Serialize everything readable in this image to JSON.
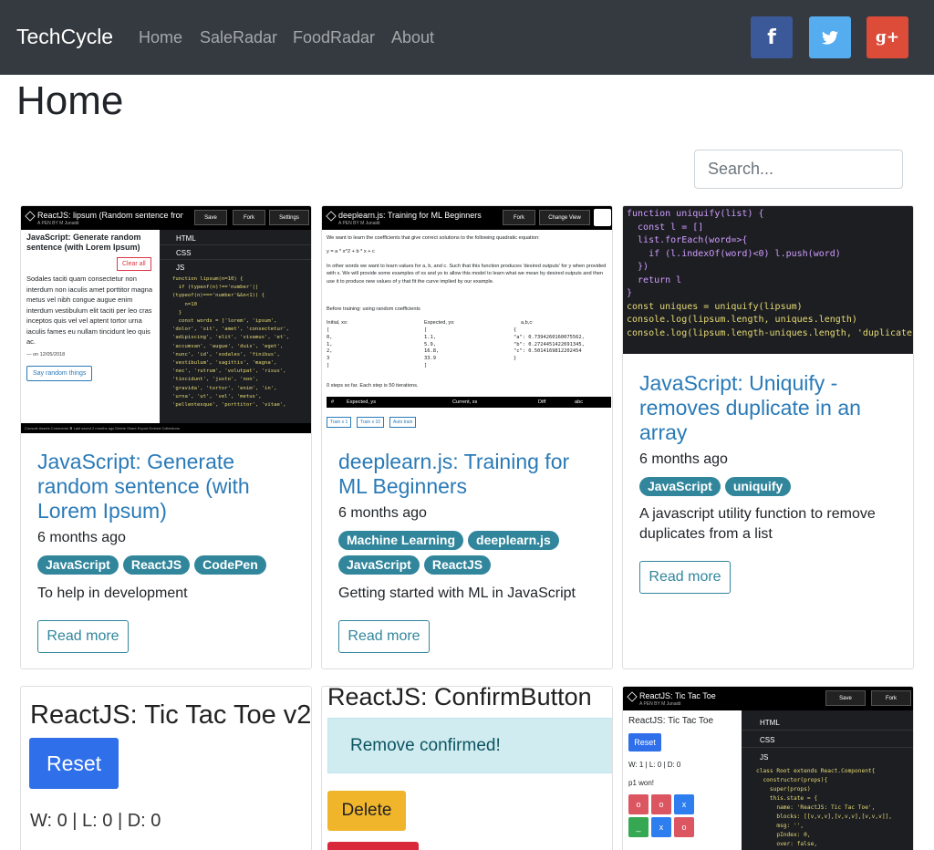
{
  "nav": {
    "brand": "TechCycle",
    "links": [
      "Home",
      "SaleRadar",
      "FoodRadar",
      "About"
    ],
    "social": [
      {
        "icon": "facebook-icon",
        "glyph": "f",
        "color": "#3b5998"
      },
      {
        "icon": "twitter-icon",
        "glyph": "",
        "color": "#55acee"
      },
      {
        "icon": "google-plus-icon",
        "glyph": "g+",
        "color": "#dd4b39"
      }
    ]
  },
  "page": {
    "title": "Home"
  },
  "search": {
    "placeholder": "Search..."
  },
  "colors": {
    "navbar": "#343a40",
    "link": "#2a7ab7",
    "tag": "#31869c"
  },
  "posts": [
    {
      "title": "JavaScript: Generate random sentence (with Lorem Ipsum)",
      "date": "6 months ago",
      "tags": [
        "JavaScript",
        "ReactJS",
        "CodePen"
      ],
      "description": "To help in development",
      "read_more": "Read more",
      "thumb": {
        "bar_title": "ReactJS: lipsum (Random sentence from ...",
        "author": "A PEN BY M Junaidi",
        "save": "Save",
        "fork": "Fork",
        "settings": "Settings",
        "heading": "JavaScript: Generate random sentence (with Lorem Ipsum)",
        "clear": "Clear all",
        "sample": "Sodales taciti quam consectetur non interdum non iaculis amet porttitor magna metus vel nibh congue augue enim interdum vestibulum elit taciti per leo cras inceptos quis vel vel aptent tortor urna iaculis fames eu nullam tincidunt leo quis ac.",
        "meta": "— on 12/05/2018",
        "say": "Say random things",
        "html": "HTML",
        "css": "CSS",
        "js": "JS",
        "code": [
          "function lipsum(n=10) {",
          "  if (typeof(n)!=='number'||",
          "(typeof(n)==='number'&&n<1)) {",
          "    n=10",
          "  }",
          "",
          "  const words = ['lorem', 'ipsum',",
          "'dolor', 'sit', 'amet', 'consectetur',",
          "'adipiscing', 'elit', 'vivamus', 'et',",
          "'accumsan', 'augue', 'duis', 'eget',",
          "'nunc', 'id', 'sodales', 'finibus',",
          "'vestibulum', 'sagittis', 'magna',",
          "'nec', 'rutrum', 'volutpat', 'risus',",
          "'tincidunt', 'justo', 'non',",
          "'gravida', 'tortor', 'enim', 'in',",
          "'urna', 'ut', 'vel', 'metus',",
          "'pellentesque', 'porttitor', 'vitae',"
        ],
        "footer": "Console   Assets   Comments   ✖   Last saved 2 months ago      Delete   Share   Export   Embed   Collections"
      }
    },
    {
      "title": "deeplearn.js: Training for ML Beginners",
      "date": "6 months ago",
      "tags": [
        "Machine Learning",
        "deeplearn.js",
        "JavaScript",
        "ReactJS"
      ],
      "description": "Getting started with ML in JavaScript",
      "read_more": "Read more",
      "thumb": {
        "bar_title": "deeplearn.js: Training for ML Beginners",
        "author": "A PEN BY M Junaidi",
        "fork": "Fork",
        "change_view": "Change View",
        "intro": "We want to learn the coefficients that give correct solutions to the following quadratic equation:",
        "equation": "y = a * x^2 + b * x + c",
        "para": "In other words we want to learn values for a, b, and c. Such that this function produces 'desired outputs' for y when provided with x. We will provide some examples of xs and ys to allow this model to learn what we mean by desired outputs and then use it to produce new values of y that fit the curve implied by our example.",
        "before": "Before training: using random coefficients",
        "cols": [
          "Initial, xs:",
          "Expected, ys:",
          "a,b,c:"
        ],
        "xs": [
          "[",
          "0,",
          "1,",
          "2,",
          "3",
          "]"
        ],
        "ys": [
          "[",
          "1.1,",
          "5.9,",
          "16.8,",
          "33.9",
          "]"
        ],
        "abc": [
          "{",
          "\"a\": 0.7394260160075562,",
          "\"b\": 0.2724451422691345,",
          "\"c\": 0.5014169812202454",
          "}",
          ""
        ],
        "steps": "0 steps so far. Each step is 50 iterations.",
        "table_head": [
          "#",
          "Expected, ys",
          "Current, xs",
          "Diff",
          "abc"
        ],
        "buttons": [
          "Train x 1",
          "Train x 10",
          "Auto train"
        ]
      }
    },
    {
      "title": "JavaScript: Uniquify - removes duplicate in an array",
      "date": "6 months ago",
      "tags": [
        "JavaScript",
        "uniquify"
      ],
      "description": "A javascript utility function to remove duplicates from a list",
      "read_more": "Read more",
      "thumb": {
        "code": [
          "function uniquify(list) {",
          "  const l = []",
          "  list.forEach(word=>{",
          "    if (l.indexOf(word)<0) l.push(word)",
          "  })",
          "  return l",
          "}",
          "",
          "const uniques = uniquify(lipsum)",
          "console.log(lipsum.length, uniques.length)",
          "console.log(lipsum.length-uniques.length, 'duplicates')"
        ]
      }
    },
    {
      "thumb": {
        "heading": "ReactJS: Tic Tac Toe v2",
        "reset": "Reset",
        "score": "W: 0 | L: 0 | D: 0"
      }
    },
    {
      "thumb": {
        "heading": "ReactJS: ConfirmButton",
        "alert": "Remove confirmed!",
        "delete": "Delete"
      }
    },
    {
      "thumb": {
        "bar_title": "ReactJS: Tic Tac Toe",
        "author": "A PEN BY M Junaidi",
        "save": "Save",
        "fork": "Fork",
        "heading": "ReactJS: Tic Tac Toe",
        "reset": "Reset",
        "score": "W: 1 | L: 0 | D: 0",
        "status": "p1 won!",
        "cells": [
          "o",
          "o",
          "x",
          "_",
          "x",
          "o"
        ],
        "html": "HTML",
        "css": "CSS",
        "js": "JS",
        "code": [
          "class Root extends React.Component{",
          "  constructor(props){",
          "    super(props)",
          "    this.state = {",
          "      name: 'ReactJS: Tic Tac Toe',",
          "      blocks: [[v,v,v],[v,v,v],[v,v,v]],",
          "      msg: '',",
          "      pIndex: 0,",
          "      over: false,"
        ]
      }
    }
  ]
}
